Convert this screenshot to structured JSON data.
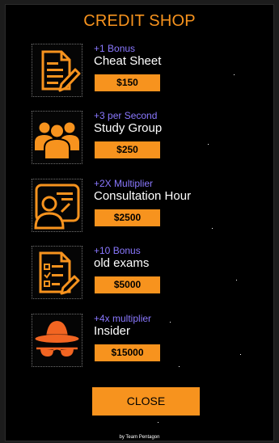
{
  "shop": {
    "title": "CREDIT SHOP",
    "close_label": "CLOSE",
    "credits": "by Team Pentagon",
    "accent_color": "#f7931e",
    "bonus_color": "#8a78ff"
  },
  "items": [
    {
      "bonus": "+1 Bonus",
      "name": "Cheat Sheet",
      "price": "$150",
      "icon": "document-pencil-icon"
    },
    {
      "bonus": "+3 per Second",
      "name": "Study Group",
      "price": "$250",
      "icon": "group-icon"
    },
    {
      "bonus": "+2X Multiplier",
      "name": "Consultation Hour",
      "price": "$2500",
      "icon": "consultation-icon"
    },
    {
      "bonus": "+10 Bonus",
      "name": "old exams",
      "price": "$5000",
      "icon": "exam-checklist-icon"
    },
    {
      "bonus": "+4x multiplier",
      "name": "Insider",
      "price": "$15000",
      "icon": "spy-icon"
    }
  ]
}
